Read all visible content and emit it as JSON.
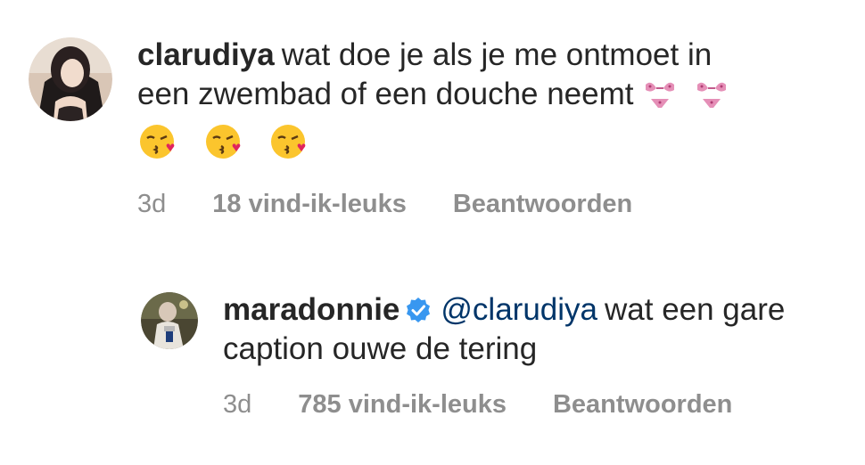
{
  "comments": [
    {
      "username": "clarudiya",
      "verified": false,
      "text_line1": "wat doe je als je me ontmoet in",
      "text_line2": "een zwembad of een douche neemt",
      "emojis_inline": [
        "bikini-icon",
        "bikini-icon"
      ],
      "emojis_row": [
        "kissing-face-icon",
        "kissing-face-icon",
        "kissing-face-icon"
      ],
      "time": "3d",
      "likes": "18 vind-ik-leuks",
      "reply_label": "Beantwoorden"
    },
    {
      "username": "maradonnie",
      "verified": true,
      "mention": "@clarudiya",
      "text": "wat een gare caption ouwe de tering",
      "time": "3d",
      "likes": "785 vind-ik-leuks",
      "reply_label": "Beantwoorden"
    }
  ],
  "colors": {
    "text": "#262626",
    "meta": "#8e8e8e",
    "mention": "#003569",
    "verified": "#3897f0"
  }
}
